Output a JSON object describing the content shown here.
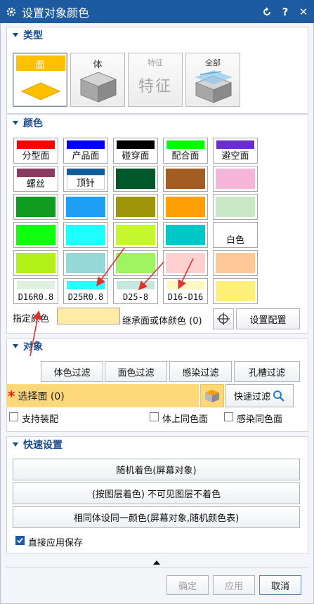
{
  "window": {
    "title": "设置对象颜色"
  },
  "sections": {
    "type": "类型",
    "color": "颜色",
    "object": "对象",
    "quick": "快速设置"
  },
  "type_buttons": [
    {
      "label": "面",
      "selected": true
    },
    {
      "label": "体"
    },
    {
      "label": "特征",
      "big": "特征",
      "disabled": true
    },
    {
      "label": "全部"
    }
  ],
  "colors": {
    "row1": [
      {
        "label": "分型面",
        "color": "#ff0000"
      },
      {
        "label": "产品面",
        "color": "#0000ff"
      },
      {
        "label": "碰穿面",
        "color": "#000000"
      },
      {
        "label": "配合面",
        "color": "#00ff00"
      },
      {
        "label": "避空面",
        "color": "#6a2fc8"
      }
    ],
    "row2": [
      {
        "label": "螺丝",
        "color": "#8b3a62"
      },
      {
        "label": "顶针",
        "color": "#105c9c"
      },
      {
        "color": "#00582a"
      },
      {
        "color": "#a35d22"
      },
      {
        "color": "#f5b6da"
      }
    ],
    "row3": [
      "#109c20",
      "#1e9ef5",
      "#9e9608",
      "#ffa006",
      "#c8e8c6"
    ],
    "row4": [
      {
        "color": "#10ff10"
      },
      {
        "color": "#20ffff"
      },
      {
        "color": "#c6f72e"
      },
      {
        "color": "#00c8c8"
      },
      {
        "label": "白色",
        "color": "#ffffff"
      }
    ],
    "row5": [
      "#b2f21a",
      "#96d8d8",
      "#a0f462",
      "#ffd0d0",
      "#ffc896"
    ],
    "row6": [
      {
        "label": "D16R0.8",
        "color": "#dff0df"
      },
      {
        "label": "D25R0.8",
        "color": "#28ffff"
      },
      {
        "label": "D25-8",
        "color": "#c6e8dc"
      },
      {
        "label": "D16-D16",
        "color": "#fff7c2"
      },
      {
        "color": "#fff07a"
      }
    ],
    "specify_label": "指定颜色",
    "specify_color": "#ffeaa6",
    "inherit_label": "继承面或体颜色 (0)",
    "config_button": "设置配置"
  },
  "object": {
    "filters": [
      "体色过滤",
      "面色过滤",
      "感染过滤",
      "孔槽过滤"
    ],
    "select_label": "选择面 (0)",
    "quick_filter": "快速过滤",
    "check_assembly": "支持装配",
    "check_body_same": "体上同色面",
    "check_infect_same": "感染同色面"
  },
  "quick": {
    "btn1": "随机着色(屏幕对象)",
    "btn2": "(按图层着色) 不可见图层不着色",
    "btn3": "相同体设同一颜色(屏幕对象,随机颜色表)",
    "apply_save": "直接应用保存"
  },
  "footer": {
    "ok": "确定",
    "apply": "应用",
    "cancel": "取消"
  },
  "icons": {
    "title": "gear-icon",
    "reset": "reset-icon",
    "help": "help-icon",
    "close": "close-icon"
  }
}
